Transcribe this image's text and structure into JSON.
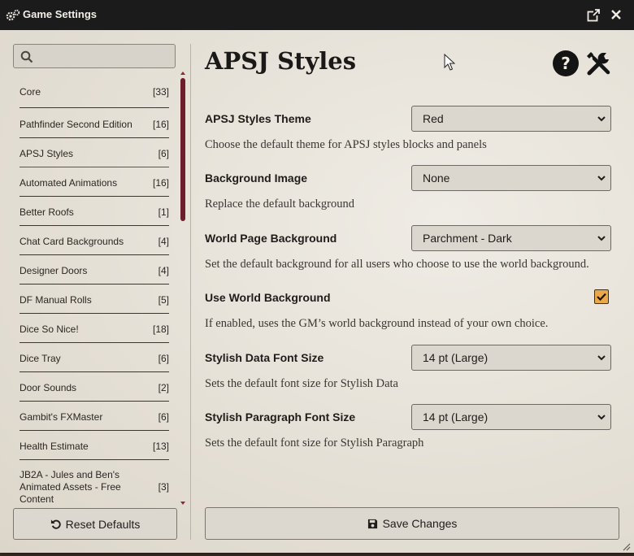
{
  "window": {
    "title": "Game Settings"
  },
  "sidebar": {
    "search_placeholder": "",
    "categories": [
      {
        "name": "Core",
        "count": "[33]"
      },
      {
        "name": "Pathfinder Second Edition",
        "count": "[16]"
      },
      {
        "name": "APSJ Styles",
        "count": "[6]",
        "active": true
      },
      {
        "name": "Automated Animations",
        "count": "[16]"
      },
      {
        "name": "Better Roofs",
        "count": "[1]"
      },
      {
        "name": "Chat Card Backgrounds",
        "count": "[4]"
      },
      {
        "name": "Designer Doors",
        "count": "[4]"
      },
      {
        "name": "DF Manual Rolls",
        "count": "[5]"
      },
      {
        "name": "Dice So Nice!",
        "count": "[18]"
      },
      {
        "name": "Dice Tray",
        "count": "[6]"
      },
      {
        "name": "Door Sounds",
        "count": "[2]"
      },
      {
        "name": "Gambit's FXMaster",
        "count": "[6]"
      },
      {
        "name": "Health Estimate",
        "count": "[13]"
      },
      {
        "name": "JB2A - Jules and Ben's Animated Assets - Free Content",
        "count": "[3]"
      }
    ],
    "reset_label": "Reset Defaults"
  },
  "main": {
    "heading": "APSJ Styles",
    "settings": [
      {
        "label": "APSJ Styles Theme",
        "value": "Red",
        "hint": "Choose the default theme for APSJ styles blocks and panels"
      },
      {
        "label": "Background Image",
        "value": "None",
        "hint": "Replace the default background"
      },
      {
        "label": "World Page Background",
        "value": "Parchment - Dark",
        "hint": "Set the default background for all users who choose to use the world background."
      },
      {
        "label": "Use World Background",
        "checked": true,
        "hint": "If enabled, uses the GM’s world background instead of your own choice."
      },
      {
        "label": "Stylish Data Font Size",
        "value": "14 pt (Large)",
        "hint": "Sets the default font size for Stylish Data"
      },
      {
        "label": "Stylish Paragraph Font Size",
        "value": "14 pt (Large)",
        "hint": "Sets the default font size for Stylish Paragraph"
      }
    ],
    "save_label": "Save Changes"
  },
  "colors": {
    "titlebar": "#1b1b1b",
    "accent_active_underline": "#b5302a",
    "scrollbar_thumb": "#6e1d2c",
    "checkbox_fill": "#e9a84a",
    "panel_bg": "#e9e5dd"
  },
  "icons": [
    "cogs-icon",
    "popout-icon",
    "close-icon",
    "search-icon",
    "undo-icon",
    "save-icon",
    "help-icon",
    "tools-icon",
    "chevron-down-icon",
    "check-icon"
  ]
}
